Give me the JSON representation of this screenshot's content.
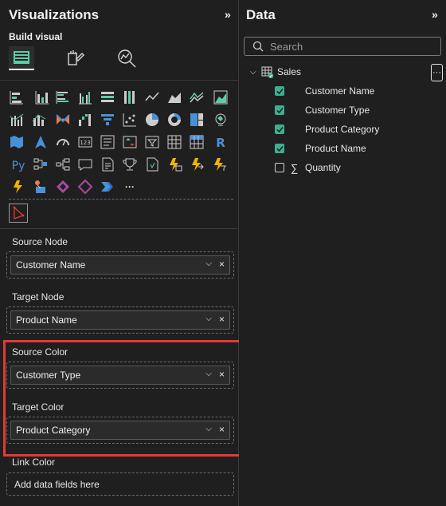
{
  "visualizations": {
    "title": "Visualizations",
    "collapse_glyph": "»",
    "build_label": "Build visual",
    "mode_icons": [
      "build-visual-icon",
      "format-visual-icon",
      "analytics-icon"
    ],
    "more_label": "···",
    "wells": [
      {
        "label": "Source Node",
        "value": "Customer Name"
      },
      {
        "label": "Target Node",
        "value": "Product Name"
      },
      {
        "label": "Source Color",
        "value": "Customer Type"
      },
      {
        "label": "Target Color",
        "value": "Product Category"
      },
      {
        "label": "Link Color",
        "placeholder": "Add data fields here"
      }
    ],
    "highlight_color": "#e53935"
  },
  "data": {
    "title": "Data",
    "collapse_glyph": "»",
    "search_placeholder": "Search",
    "table": {
      "name": "Sales",
      "more": "···"
    },
    "fields": [
      {
        "name": "Customer Name",
        "checked": true
      },
      {
        "name": "Customer Type",
        "checked": true
      },
      {
        "name": "Product Category",
        "checked": true
      },
      {
        "name": "Product Name",
        "checked": true
      },
      {
        "name": "Quantity",
        "checked": false,
        "sigma": "∑"
      }
    ],
    "check_color": "#3fae8f"
  }
}
